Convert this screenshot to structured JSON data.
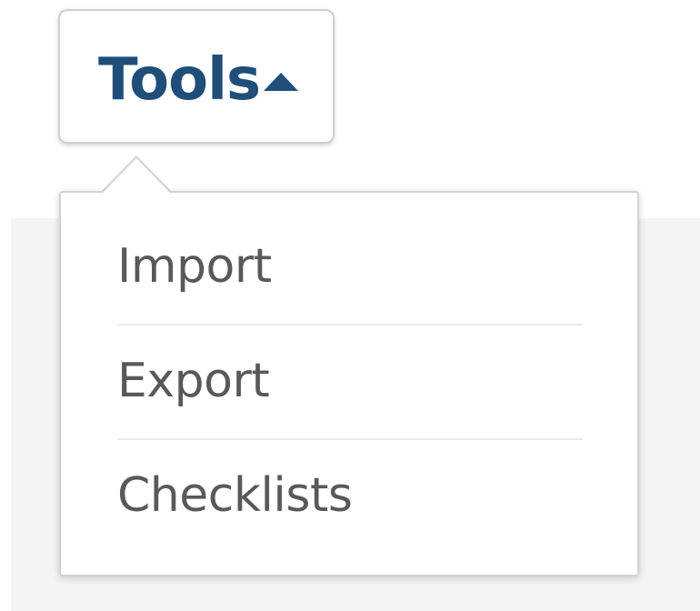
{
  "tools_button": {
    "label": "Tools",
    "state": "expanded",
    "caret_icon": "caret-up-icon",
    "label_color": "#1f4e79"
  },
  "dropdown": {
    "items": [
      {
        "label": "Import"
      },
      {
        "label": "Export"
      },
      {
        "label": "Checklists"
      }
    ],
    "item_color": "#595959"
  }
}
